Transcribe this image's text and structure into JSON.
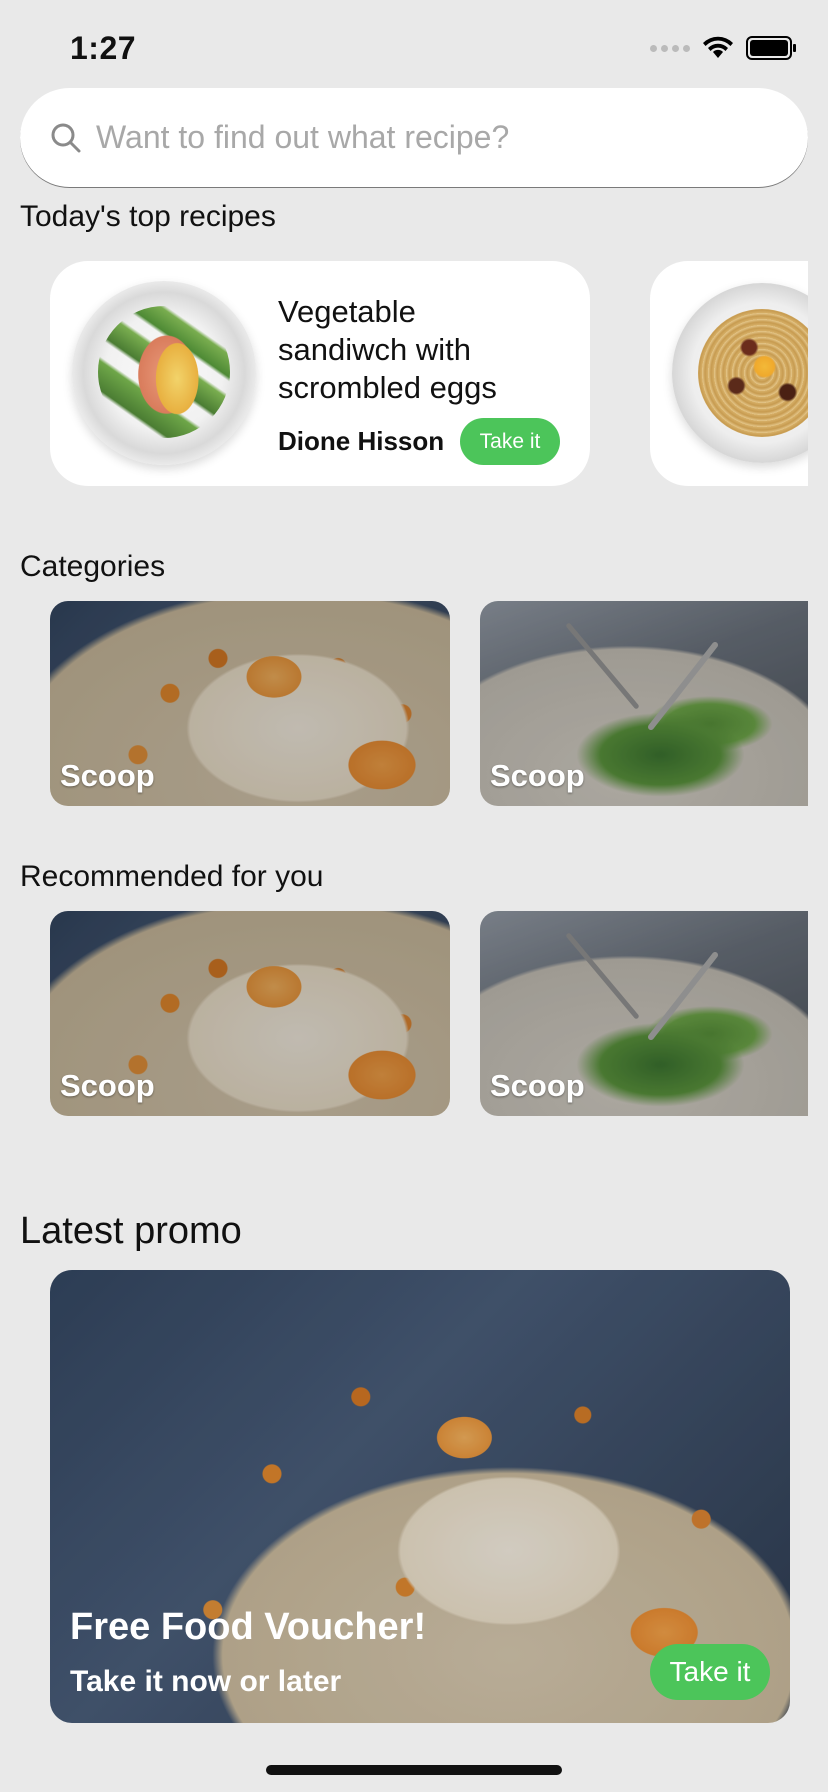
{
  "status": {
    "time": "1:27"
  },
  "search": {
    "placeholder": "Want to find out what recipe?"
  },
  "top_recipes": {
    "title": "Today's top recipes",
    "cards": [
      {
        "name": "Vegetable sandiwch with scrombled eggs",
        "author": "Dione Hisson",
        "action": "Take it"
      }
    ]
  },
  "categories": {
    "title": "Categories",
    "items": [
      {
        "label": "Scoop"
      },
      {
        "label": "Scoop"
      }
    ]
  },
  "recommended": {
    "title": "Recommended for you",
    "items": [
      {
        "label": "Scoop"
      },
      {
        "label": "Scoop"
      }
    ]
  },
  "promo": {
    "title": "Latest promo",
    "headline": "Free Food Voucher!",
    "subtitle": "Take it now or later",
    "action": "Take it"
  },
  "colors": {
    "accent": "#4cc55a",
    "background": "#e9e9e9"
  },
  "icons": {
    "search": "search-icon",
    "signal": "signal-dots-icon",
    "wifi": "wifi-icon",
    "battery": "battery-icon"
  }
}
